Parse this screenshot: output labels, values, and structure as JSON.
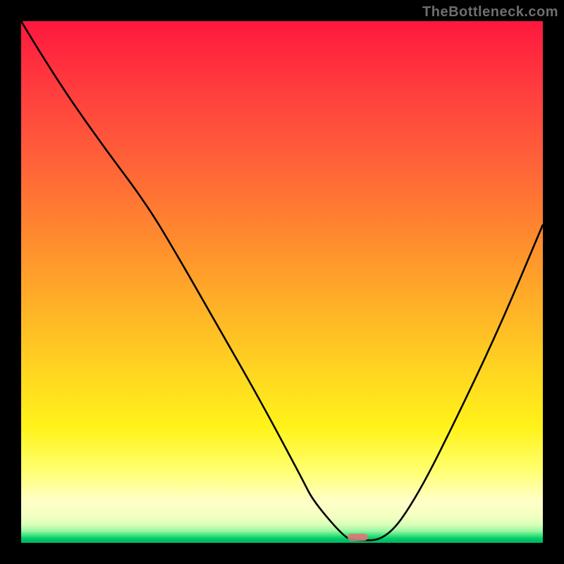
{
  "watermark": "TheBottleneck.com",
  "chart_data": {
    "type": "line",
    "title": "",
    "xlabel": "",
    "ylabel": "",
    "xlim": [
      0,
      100
    ],
    "ylim": [
      0,
      100
    ],
    "grid": false,
    "legend": false,
    "series": [
      {
        "name": "bottleneck-curve",
        "x": [
          0,
          6,
          15,
          24,
          30,
          38,
          46,
          54,
          56,
          62,
          64,
          70,
          76,
          84,
          92,
          100
        ],
        "values": [
          100,
          90,
          77,
          65,
          55,
          41,
          27,
          12,
          8,
          1,
          0.5,
          0.5,
          9,
          25,
          42,
          61
        ]
      }
    ],
    "marker": {
      "name": "optimal-band",
      "x_start": 62.5,
      "x_end": 66.5,
      "y": 0.5
    },
    "background_gradient": {
      "top": "#ff173e",
      "mid": "#ffd820",
      "bottom": "#00b45e"
    }
  }
}
